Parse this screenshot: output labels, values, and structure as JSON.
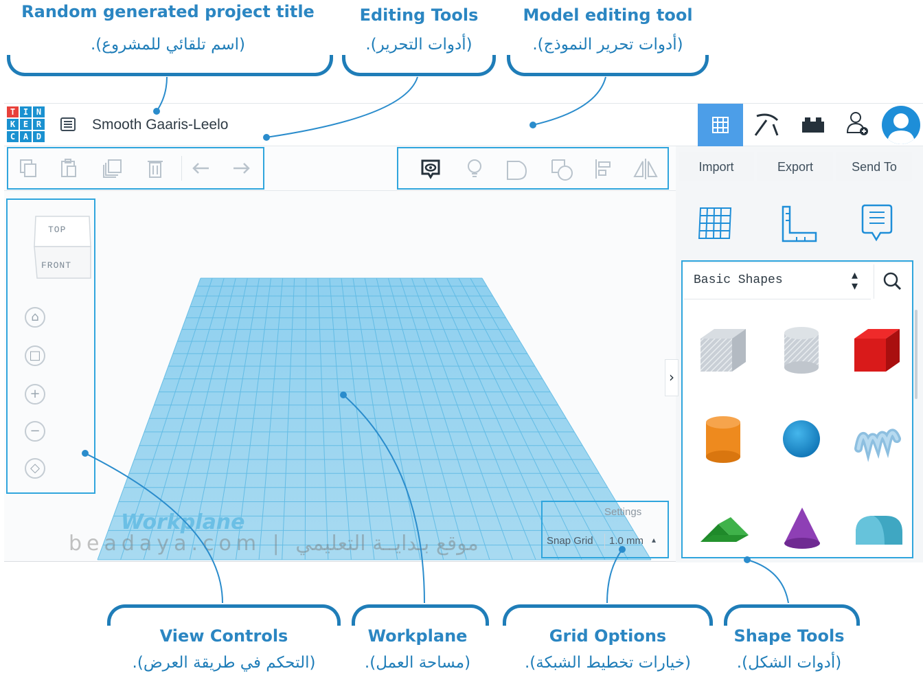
{
  "callouts": {
    "project_title": {
      "title": "Random generated project title",
      "ar": "(اسم تلقائي للمشروع)."
    },
    "editing_tools": {
      "title": "Editing Tools",
      "ar": "(أدوات التحرير)."
    },
    "model_editing": {
      "title": "Model editing tool",
      "ar": "(أدوات تحرير النموذج)."
    },
    "view_controls": {
      "title": "View Controls",
      "ar": "(التحكم في طريقة العرض)."
    },
    "workplane": {
      "title": "Workplane",
      "ar": "(مساحة العمل)."
    },
    "grid_options": {
      "title": "Grid Options",
      "ar": "(خيارات تخطيط الشبكة)."
    },
    "shape_tools": {
      "title": "Shape Tools",
      "ar": "(أدوات الشكل)."
    }
  },
  "app": {
    "logo_letters": [
      "T",
      "I",
      "N",
      "K",
      "E",
      "R",
      "C",
      "A",
      "D"
    ],
    "logo_colors": [
      "#e8413b",
      "#1a91d0",
      "#1a91d0",
      "#1a91d0",
      "#1a91d0",
      "#1a91d0",
      "#1a91d0",
      "#1a91d0",
      "#1a91d0"
    ],
    "project_title": "Smooth Gaaris-Leelo",
    "menu_icon": "list-icon"
  },
  "header_right": {
    "icons": [
      "grid-view-icon",
      "pickaxe-icon",
      "bricks-icon",
      "add-user-icon",
      "avatar-icon"
    ],
    "active_color": "#4c9ee8"
  },
  "toolbar": {
    "edit_icons": [
      "copy-icon",
      "paste-icon",
      "duplicate-icon",
      "delete-icon",
      "undo-icon",
      "redo-icon"
    ],
    "model_icons": [
      "show-all-icon",
      "lightbulb-icon",
      "group-icon",
      "ungroup-icon",
      "align-icon",
      "mirror-icon"
    ],
    "import_label": "Import",
    "export_label": "Export",
    "send_to_label": "Send To"
  },
  "view_cube": {
    "top": "TOP",
    "front": "FRONT"
  },
  "view_buttons": [
    "home-icon",
    "fit-icon",
    "zoom-in-icon",
    "zoom-out-icon",
    "ortho-icon"
  ],
  "panel_tabs": [
    "grid-panel-icon",
    "ruler-icon",
    "notes-icon"
  ],
  "shapes": {
    "category": "Basic Shapes",
    "items": [
      "Box Hole",
      "Cylinder Hole",
      "Box",
      "Cylinder",
      "Sphere",
      "Scribble",
      "Roof",
      "Cone",
      "Round Roof"
    ]
  },
  "workplane": {
    "label": "Workplane",
    "grid_color": "#5ab8e3"
  },
  "grid": {
    "settings_label": "Settings",
    "snap_label": "Snap Grid",
    "snap_value": "1.0 mm"
  },
  "watermark": {
    "text": "beadaya.com | موقع بـدايــة التعليمي"
  }
}
